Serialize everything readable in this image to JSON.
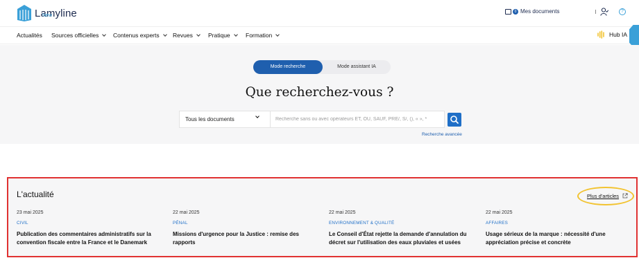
{
  "header": {
    "logo_text": "Lamyline",
    "logo_sub": "New",
    "my_documents_label": "Mes documents",
    "my_documents_count": "0",
    "help_glyph": "?",
    "icons": [
      "logo-mark",
      "folder-icon",
      "user-icon",
      "help-icon",
      "hub-ia-icon"
    ]
  },
  "nav": {
    "items": [
      {
        "label": "Actualités",
        "dropdown": false
      },
      {
        "label": "Sources officielles",
        "dropdown": true
      },
      {
        "label": "Contenus experts",
        "dropdown": true
      },
      {
        "label": "Revues",
        "dropdown": true
      },
      {
        "label": "Pratique",
        "dropdown": true
      },
      {
        "label": "Formation",
        "dropdown": true
      }
    ],
    "hub_label": "Hub IA"
  },
  "search": {
    "modes": [
      "Mode recherche",
      "Mode assistant IA"
    ],
    "active_mode": "Mode recherche",
    "question": "Que recherchez-vous ?",
    "scope_selected": "Tous les documents",
    "placeholder": "Recherche sans ou avec opérateurs ET, OU, SAUF, PRE/, S/, (), « », *",
    "advanced_label": "Recherche avancée"
  },
  "news": {
    "title": "L'actualité",
    "more_label": "Plus d'articles",
    "articles": [
      {
        "date": "23 mai 2025",
        "category": "CIVIL",
        "title": "Publication des commentaires administratifs sur la convention fiscale entre la France et le Danemark"
      },
      {
        "date": "22 mai 2025",
        "category": "PÉNAL",
        "title": "Missions d'urgence pour la Justice : remise des rapports"
      },
      {
        "date": "22 mai 2025",
        "category": "ENVIRONNEMENT & QUALITÉ",
        "title": "Le Conseil d'État rejette la demande d'annulation du décret sur l'utilisation des eaux pluviales et usées"
      },
      {
        "date": "22 mai 2025",
        "category": "AFFAIRES",
        "title": "Usage sérieux de la marque : nécessité d'une appréciation précise et concrète"
      }
    ]
  },
  "colors": {
    "brand_blue": "#1f5fae",
    "accent_light_blue": "#3aa0d8",
    "highlight_red": "#e03131",
    "highlight_yellow": "#f2c330"
  }
}
